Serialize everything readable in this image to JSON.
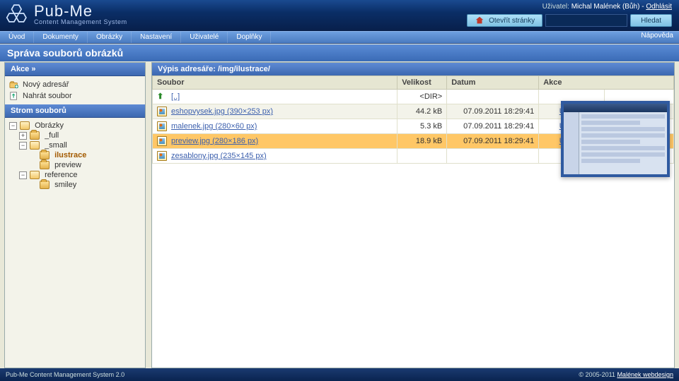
{
  "brand": {
    "title": "Pub-Me",
    "subtitle": "Content Management System"
  },
  "user": {
    "label": "Uživatel:",
    "name": "Michal Malének (Bůh)",
    "logout": "Odhlásit"
  },
  "open_pages": {
    "button": "Otevřít stránky",
    "search_button": "Hledat"
  },
  "menu": {
    "items": [
      "Úvod",
      "Dokumenty",
      "Obrázky",
      "Nastavení",
      "Uživatelé",
      "Doplňky"
    ],
    "right": "Nápověda"
  },
  "page_title": "Správa souborů obrázků",
  "sidebar": {
    "actions_head": "Akce »",
    "actions": [
      {
        "icon": "folder-new-icon",
        "label": "Nový adresář"
      },
      {
        "icon": "upload-icon",
        "label": "Nahrát soubor"
      }
    ],
    "tree_head": "Strom souborů",
    "tree": {
      "root": "Obrázky",
      "children": [
        {
          "label": "_full",
          "expandable": true
        },
        {
          "label": "_small",
          "expandable": true,
          "open": true,
          "children": [
            {
              "label": "ilustrace",
              "selected": true
            },
            {
              "label": "preview"
            }
          ]
        },
        {
          "label": "reference",
          "expandable": true,
          "children_hidden": [
            {
              "label": "smiley"
            }
          ]
        }
      ],
      "smiley": "smiley"
    }
  },
  "listing": {
    "head_prefix": "Výpis adresáře: ",
    "path": "/img/ilustrace/",
    "columns": {
      "file": "Soubor",
      "size": "Velikost",
      "date": "Datum",
      "act": "Akce"
    },
    "action_labels": {
      "show": "Ukázat",
      "del": "Smazat"
    },
    "parent": "[..]",
    "dir_marker": "<DIR>",
    "rows": [
      {
        "name": "eshopvysek.jpg",
        "dims": "(390×253 px)",
        "size": "44.2 kB",
        "date": "07.09.2011 18:29:41",
        "alt": true
      },
      {
        "name": "malenek.jpg",
        "dims": "(280×60 px)",
        "size": "5.3 kB",
        "date": "07.09.2011 18:29:41"
      },
      {
        "name": "preview.jpg",
        "dims": "(280×186 px)",
        "size": "18.9 kB",
        "date": "07.09.2011 18:29:41",
        "active": true
      },
      {
        "name": "zesablony.jpg",
        "dims": "(235×145 px)",
        "size": "",
        "date": ""
      }
    ]
  },
  "footer": {
    "left": "Pub-Me Content Management System 2.0",
    "copy": "© 2005-2011 ",
    "link": "Malének webdesign"
  }
}
